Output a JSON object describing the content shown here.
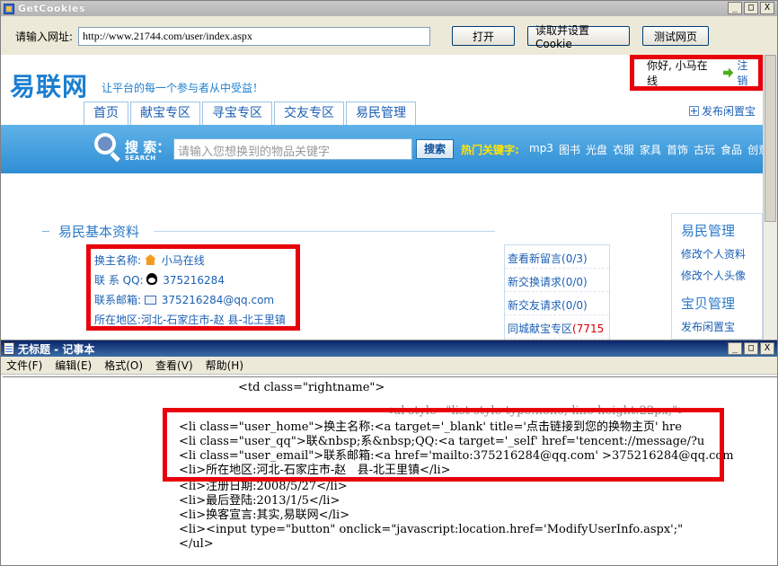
{
  "win1": {
    "title": "GetCookies",
    "min": "_",
    "max": "□",
    "close": "X",
    "url_label": "请输入网址:",
    "url_value": "http://www.21744.com/user/index.aspx",
    "btn_open": "打开",
    "btn_read": "读取并设置Cookie",
    "btn_test": "测试网页"
  },
  "site": {
    "logo": "易联网",
    "slogan": "让平台的每一个参与者从中受益！",
    "hello": "你好, 小马在线",
    "register": "注销",
    "nav": [
      "首页",
      "献宝专区",
      "寻宝专区",
      "交友专区",
      "易民管理"
    ],
    "post_free": "发布闲置宝",
    "search_title": "搜 索：",
    "search_sub": "SEARCH",
    "search_placeholder": "请输入您想换到的物品关键字",
    "search_btn": "搜索",
    "hot_label": "热门关键字:",
    "hot": [
      "mp3",
      "图书",
      "光盘",
      "衣服",
      "家具",
      "首饰",
      "古玩",
      "食品",
      "创意"
    ],
    "section_title": "易民基本资料",
    "profile": {
      "name_label": "换主名称:",
      "name_value": "小马在线",
      "qq_label": "联 系 QQ:",
      "qq_value": "375216284",
      "email_label": "联系邮箱:",
      "email_value": "375216284@qq.com",
      "area_label": "所在地区:",
      "area_value": "河北-石家庄市-赵   县-北王里镇"
    },
    "messages": [
      {
        "label": "查看新留言",
        "count": "(0/3)"
      },
      {
        "label": "新交换请求",
        "count": "(0/0)"
      },
      {
        "label": "新交友请求",
        "count": "(0/0)"
      },
      {
        "label": "同城献宝专区",
        "count": "(7715"
      }
    ],
    "side": {
      "h1": "易民管理",
      "items1": [
        "修改个人资料",
        "修改个人头像"
      ],
      "h2": "宝贝管理",
      "items2": [
        "发布闲置宝"
      ]
    }
  },
  "win2": {
    "title": "无标题 - 记事本",
    "menus": [
      "文件(F)",
      "编辑(E)",
      "格式(O)",
      "查看(V)",
      "帮助(H)"
    ],
    "lines": [
      "<td class=\"rightname\">",
      "<ul style=\"list-style-type:none; line-height:22px;\">",
      "<li class=\"user_home\">换主名称:<a target='_blank' title='点击链接到您的换物主页' hre",
      "<li class=\"user_qq\">联&nbsp;系&nbsp;QQ:<a target='_self' href='tencent://message/?u",
      "<li class=\"user_email\">联系邮箱:<a href='mailto:375216284@qq.com' >375216284@qq.com",
      "<li>所在地区:河北-石家庄市-赵   县-北王里镇</li>",
      "<li>注册日期:2008/5/27</li>",
      "<li>最后登陆:2013/1/5</li>",
      "<li>换客宣言:其实,易联网</li>",
      "<li><input type=\"button\" onclick=\"javascript:location.href='ModifyUserInfo.aspx';\" ",
      "</ul>"
    ]
  }
}
